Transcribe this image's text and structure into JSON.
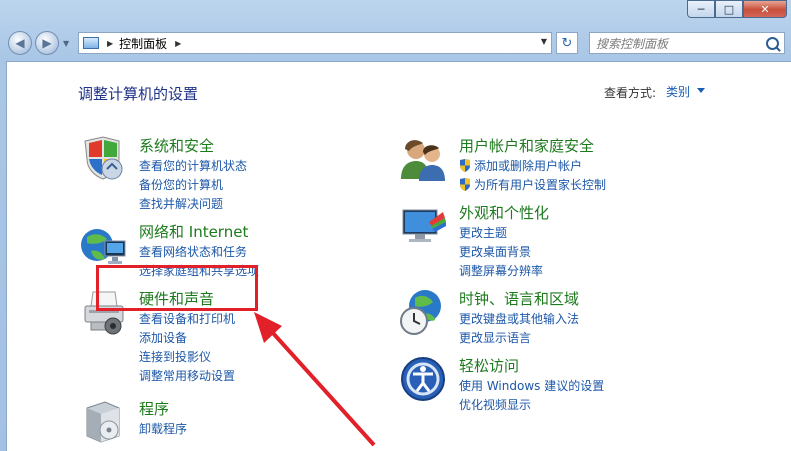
{
  "window": {
    "minimize": "─",
    "maximize": "□",
    "close": "✕"
  },
  "nav": {
    "back": "◀",
    "forward": "▶",
    "address": "控制面板",
    "search_placeholder": "搜索控制面板",
    "refresh": "↻"
  },
  "page": {
    "title": "调整计算机的设置",
    "view_by_label": "查看方式:",
    "view_by_value": "类别"
  },
  "categories": [
    {
      "title": "系统和安全",
      "icon": "system-security-icon",
      "links": [
        "查看您的计算机状态",
        "备份您的计算机",
        "查找并解决问题"
      ]
    },
    {
      "title": "网络和 Internet",
      "icon": "network-internet-icon",
      "links": [
        "查看网络状态和任务",
        "选择家庭组和共享选项"
      ]
    },
    {
      "title": "硬件和声音",
      "icon": "hardware-sound-icon",
      "links": [
        "查看设备和打印机",
        "添加设备",
        "连接到投影仪",
        "调整常用移动设置"
      ]
    },
    {
      "title": "程序",
      "icon": "programs-icon",
      "links": [
        "卸载程序"
      ]
    },
    {
      "title": "用户帐户和家庭安全",
      "icon": "user-accounts-icon",
      "links": [
        "添加或删除用户帐户",
        "为所有用户设置家长控制"
      ]
    },
    {
      "title": "外观和个性化",
      "icon": "appearance-icon",
      "links": [
        "更改主题",
        "更改桌面背景",
        "调整屏幕分辨率"
      ]
    },
    {
      "title": "时钟、语言和区域",
      "icon": "clock-language-icon",
      "links": [
        "更改键盘或其他输入法",
        "更改显示语言"
      ]
    },
    {
      "title": "轻松访问",
      "icon": "ease-of-access-icon",
      "links": [
        "使用 Windows 建议的设置",
        "优化视频显示"
      ]
    }
  ],
  "annotation": {
    "highlight_color": "#e2202a"
  }
}
